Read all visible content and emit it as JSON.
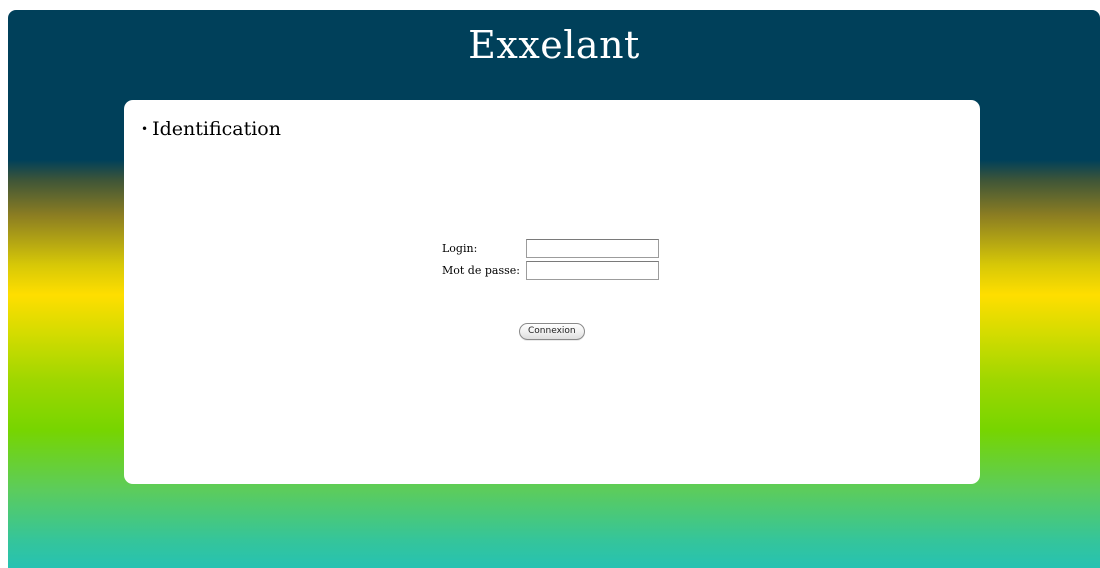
{
  "header": {
    "title": "Exxelant"
  },
  "panel": {
    "heading": "Identification",
    "bullet": "•"
  },
  "form": {
    "login_label": "Login:",
    "login_value": "",
    "password_label": "Mot de passe:",
    "password_value": "",
    "submit_label": "Connexion"
  },
  "colors": {
    "header_background": "#00405a",
    "gradient_yellow": "#ffde00",
    "gradient_green": "#77d500",
    "gradient_teal": "#26c2b2",
    "panel_background": "#ffffff"
  }
}
